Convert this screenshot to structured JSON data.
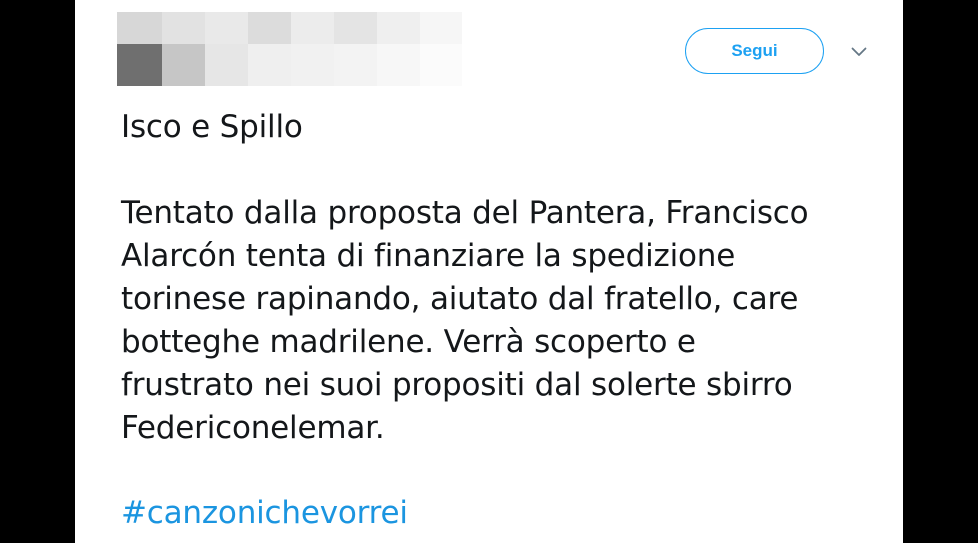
{
  "header": {
    "follow_label": "Segui",
    "caret_icon": "chevron-down-icon"
  },
  "tweet": {
    "title": "Isco e Spillo",
    "body_lines": [
      "Tentato dalla proposta del Pantera, Francisco",
      "Alarcón tenta di finanziare la spedizione",
      "torinese rapinando, aiutato dal fratello, care",
      "botteghe madrilene. Verrà scoperto e",
      "frustrato nei suoi propositi dal solerte sbirro",
      "Federiconelemar."
    ],
    "hashtag": "#canzonichevorrei"
  },
  "colors": {
    "accent": "#1da1f2",
    "link": "#1b95e0",
    "text": "#14171a",
    "backdrop": "#000000"
  }
}
